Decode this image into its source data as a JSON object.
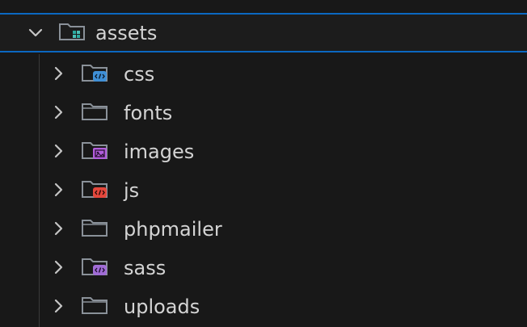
{
  "explorer": {
    "root": {
      "label": "assets",
      "icon": "folder-assets-icon",
      "expanded": true
    },
    "items": [
      {
        "label": "css",
        "icon": "folder-css-icon",
        "expanded": false
      },
      {
        "label": "fonts",
        "icon": "folder-icon",
        "expanded": false
      },
      {
        "label": "images",
        "icon": "folder-images-icon",
        "expanded": false
      },
      {
        "label": "js",
        "icon": "folder-js-icon",
        "expanded": false
      },
      {
        "label": "phpmailer",
        "icon": "folder-icon",
        "expanded": false
      },
      {
        "label": "sass",
        "icon": "folder-sass-icon",
        "expanded": false
      },
      {
        "label": "uploads",
        "icon": "folder-icon",
        "expanded": false
      }
    ],
    "colors": {
      "selection_border": "#0b68c1",
      "folder_outline": "#8a9199",
      "css_badge": "#3f8fd6",
      "images_badge": "#b15ddb",
      "js_badge": "#e4473c",
      "sass_badge": "#a06cd5",
      "assets_badge": "#2aa9a0"
    }
  }
}
